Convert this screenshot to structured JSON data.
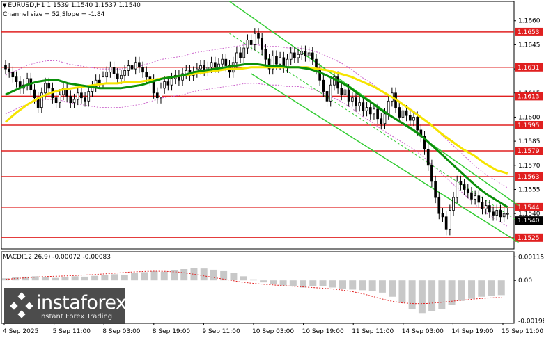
{
  "header": {
    "symbol_line": "EURUSD,H1  1.1539 1.1540 1.1537 1.1540",
    "channel_line": "Channel size = 52,Slope = -1.84"
  },
  "macd": {
    "label": "MACD(12,26,9) -0.00072 -0.00083"
  },
  "watermark": {
    "brand": "instaforex",
    "tagline": "Instant Forex Trading"
  },
  "colors": {
    "background": "#ffffff",
    "bull_candle": "#000000",
    "bear_candle": "#000000",
    "ma_fast": "#0a8f0a",
    "ma_slow": "#f5e400",
    "channel": "#33cc33",
    "level_line": "#e02020",
    "level_label_bg": "#e02020",
    "current_price_bg": "#000000",
    "bollinger": "#cc66cc",
    "macd_hist": "#c8c8c8",
    "macd_signal": "#e02020"
  },
  "chart_data": {
    "type": "candlestick",
    "symbol": "EURUSD",
    "timeframe": "H1",
    "price_axis": {
      "ylim": [
        1.1518,
        1.1672
      ],
      "ticks": [
        1.166,
        1.1645,
        1.163,
        1.1615,
        1.16,
        1.1585,
        1.157,
        1.1555,
        1.154
      ]
    },
    "time_axis": {
      "labels": [
        "4 Sep 2025",
        "5 Sep 11:00",
        "8 Sep 03:00",
        "8 Sep 19:00",
        "9 Sep 11:00",
        "10 Sep 03:00",
        "10 Sep 19:00",
        "11 Sep 11:00",
        "14 Sep 03:00",
        "14 Sep 19:00",
        "15 Sep 11:00"
      ]
    },
    "levels": [
      1.1653,
      1.1631,
      1.1613,
      1.1595,
      1.1579,
      1.1563,
      1.1544,
      1.1525
    ],
    "current_price": 1.154,
    "closes": [
      1.163,
      1.1628,
      1.1625,
      1.1622,
      1.1618,
      1.162,
      1.1624,
      1.1617,
      1.1612,
      1.1606,
      1.1615,
      1.1621,
      1.1618,
      1.1612,
      1.1609,
      1.1614,
      1.1618,
      1.1613,
      1.1609,
      1.1611,
      1.1615,
      1.1612,
      1.161,
      1.1616,
      1.1619,
      1.1623,
      1.1621,
      1.1625,
      1.1628,
      1.1631,
      1.1627,
      1.1624,
      1.1626,
      1.1629,
      1.1632,
      1.163,
      1.1634,
      1.1631,
      1.1628,
      1.1625,
      1.1623,
      1.1615,
      1.1612,
      1.1618,
      1.1622,
      1.162,
      1.1624,
      1.1626,
      1.1623,
      1.1627,
      1.1629,
      1.1626,
      1.1628,
      1.163,
      1.1632,
      1.1629,
      1.1631,
      1.1634,
      1.1631,
      1.1633,
      1.1636,
      1.1632,
      1.1628,
      1.1634,
      1.164,
      1.1637,
      1.1643,
      1.1648,
      1.1645,
      1.1652,
      1.1649,
      1.1642,
      1.1636,
      1.163,
      1.1638,
      1.1633,
      1.1637,
      1.1631,
      1.1636,
      1.164,
      1.1637,
      1.1639,
      1.1641,
      1.1638,
      1.164,
      1.1636,
      1.163,
      1.1623,
      1.1616,
      1.161,
      1.162,
      1.1625,
      1.1618,
      1.1614,
      1.1617,
      1.161,
      1.1612,
      1.1607,
      1.1609,
      1.1604,
      1.1606,
      1.1602,
      1.1605,
      1.1599,
      1.1596,
      1.1602,
      1.161,
      1.1615,
      1.1606,
      1.16,
      1.1604,
      1.1601,
      1.1598,
      1.16,
      1.1592,
      1.1588,
      1.158,
      1.157,
      1.156,
      1.155,
      1.154,
      1.1538,
      1.153,
      1.1542,
      1.155,
      1.156,
      1.1558,
      1.1555,
      1.1553,
      1.1549,
      1.1551,
      1.1547,
      1.1543,
      1.1545,
      1.1541,
      1.1539,
      1.1542,
      1.1538,
      1.154,
      1.154
    ],
    "ma_fast": [
      1.1614,
      1.1617,
      1.162,
      1.1622,
      1.1623,
      1.1623,
      1.1621,
      1.162,
      1.1619,
      1.1618,
      1.1618,
      1.1618,
      1.1619,
      1.162,
      1.1622,
      1.1624,
      1.1625,
      1.1626,
      1.1628,
      1.1629,
      1.163,
      1.1631,
      1.1632,
      1.1633,
      1.1633,
      1.1632,
      1.1632,
      1.1631,
      1.1631,
      1.163,
      1.1628,
      1.1625,
      1.1622,
      1.1618,
      1.1613,
      1.1609,
      1.1604,
      1.16,
      1.1596,
      1.1592,
      1.1587,
      1.1581,
      1.1575,
      1.1569,
      1.1563,
      1.1557,
      1.1552,
      1.1548,
      1.1544
    ],
    "ma_fast_start_index": 0,
    "ma_slow": [
      1.1597,
      1.1603,
      1.1608,
      1.1612,
      1.1615,
      1.1617,
      1.1618,
      1.1619,
      1.162,
      1.1621,
      1.1621,
      1.1622,
      1.1622,
      1.1623,
      1.1624,
      1.1625,
      1.1626,
      1.1627,
      1.1628,
      1.1629,
      1.163,
      1.163,
      1.1631,
      1.1631,
      1.1631,
      1.1631,
      1.1631,
      1.1631,
      1.163,
      1.1629,
      1.1627,
      1.1625,
      1.1622,
      1.1619,
      1.1615,
      1.1611,
      1.1606,
      1.1601,
      1.1596,
      1.159,
      1.1585,
      1.158,
      1.1576,
      1.1571,
      1.1567,
      1.1565
    ],
    "macd_axis": {
      "ylim": [
        -0.0021,
        0.0014
      ],
      "ticks": [
        0.00115,
        0.0,
        -0.00198
      ]
    },
    "macd_hist": [
      0.0001,
      0.00015,
      0.00018,
      0.0002,
      0.00015,
      0.00012,
      0.00016,
      0.0002,
      0.00018,
      0.00022,
      0.00025,
      0.0003,
      0.00028,
      0.00035,
      0.0004,
      0.00045,
      0.00042,
      0.0005,
      0.00055,
      0.0006,
      0.00058,
      0.00052,
      0.00045,
      0.00035,
      0.0002,
      5e-05,
      -0.0001,
      -0.0002,
      -0.00025,
      -0.0003,
      -0.00035,
      -0.0003,
      -0.00028,
      -0.00035,
      -0.0004,
      -0.00045,
      -0.00048,
      -0.00052,
      -0.0006,
      -0.0008,
      -0.0011,
      -0.0014,
      -0.0016,
      -0.0015,
      -0.0014,
      -0.0012,
      -0.001,
      -0.0009,
      -0.0008,
      -0.00075,
      -0.00072
    ],
    "macd_signal": [
      5e-05,
      0.0001,
      0.00014,
      0.00018,
      0.0002,
      0.00022,
      0.00025,
      0.00028,
      0.00032,
      0.00036,
      0.0004,
      0.00043,
      0.00045,
      0.00044,
      0.0004,
      0.00032,
      0.00022,
      0.00012,
      2e-05,
      -8e-05,
      -0.00015,
      -0.0002,
      -0.00024,
      -0.00028,
      -0.00032,
      -0.00036,
      -0.0004,
      -0.00046,
      -0.00055,
      -0.00068,
      -0.00085,
      -0.001,
      -0.0011,
      -0.00114,
      -0.00113,
      -0.00108,
      -0.00102,
      -0.00096,
      -0.0009,
      -0.00086,
      -0.00083
    ]
  }
}
